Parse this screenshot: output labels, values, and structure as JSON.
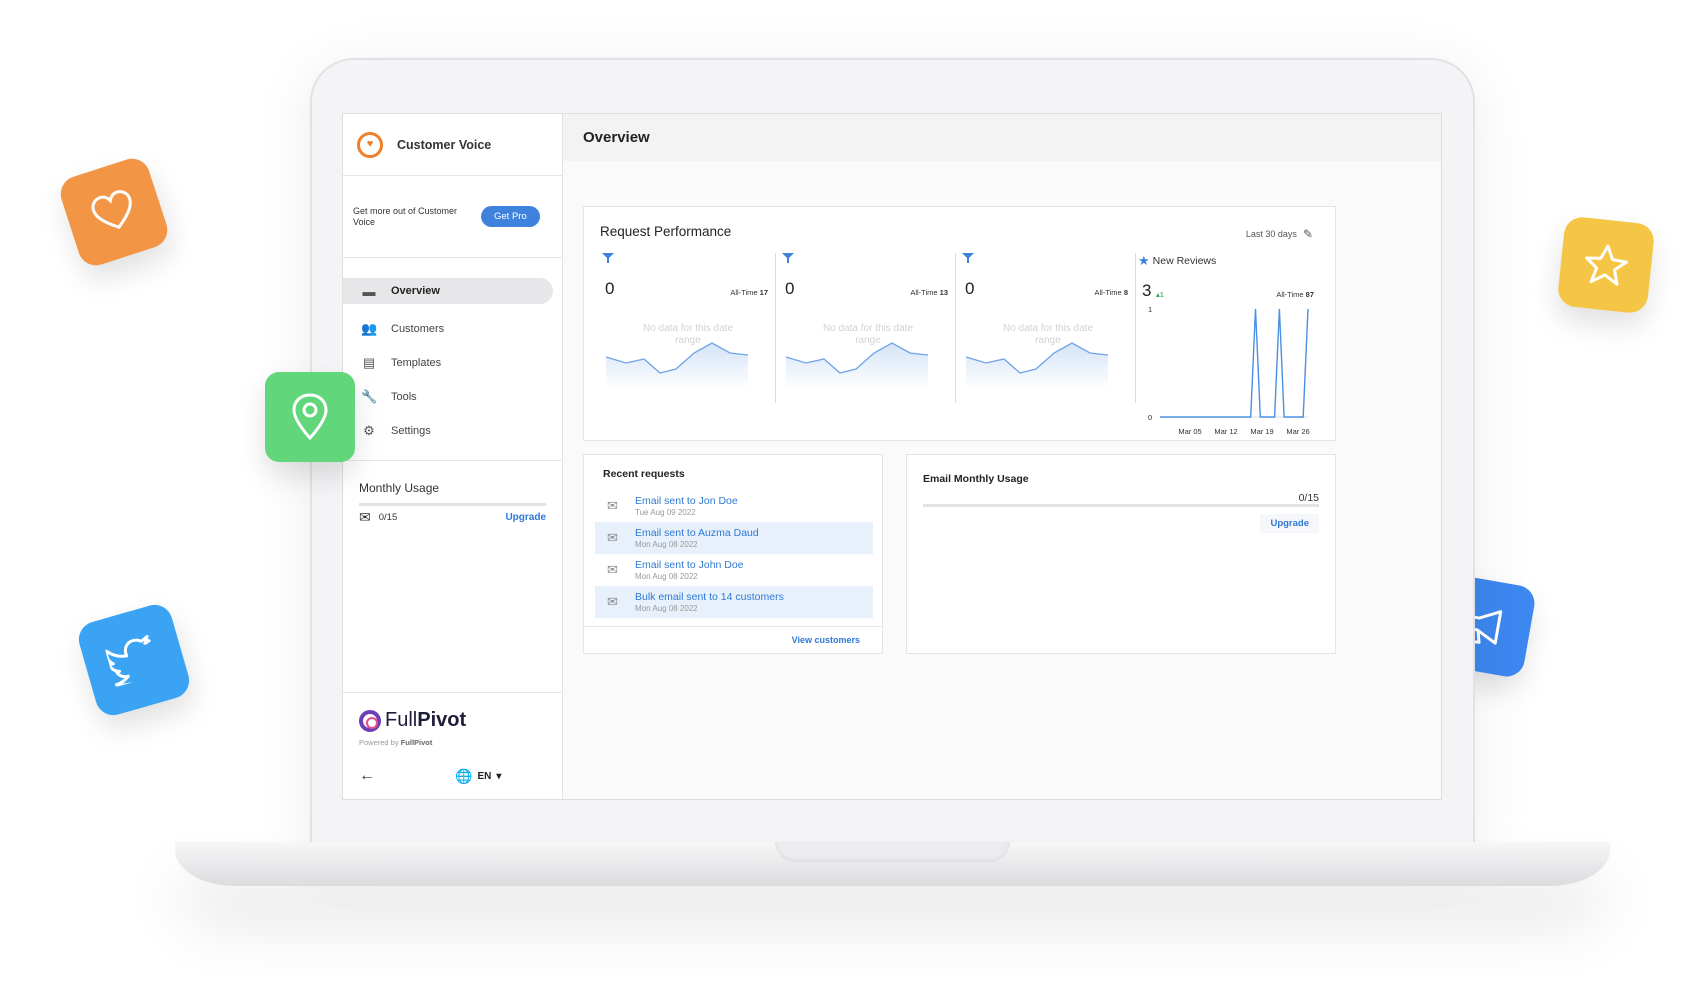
{
  "app": {
    "name": "Customer Voice",
    "promo_text": "Get more out of Customer Voice",
    "get_pro_label": "Get Pro"
  },
  "sidebar": {
    "items": [
      {
        "label": "Overview",
        "icon": "dashboard-icon",
        "glyph": "▬"
      },
      {
        "label": "Customers",
        "icon": "people-icon",
        "glyph": "👥"
      },
      {
        "label": "Templates",
        "icon": "template-icon",
        "glyph": "▤"
      },
      {
        "label": "Tools",
        "icon": "wrench-icon",
        "glyph": "🔧"
      },
      {
        "label": "Settings",
        "icon": "gear-icon",
        "glyph": "⚙"
      }
    ],
    "usage": {
      "title": "Monthly Usage",
      "count": "0/15",
      "upgrade_label": "Upgrade"
    }
  },
  "footer": {
    "brand_light": "Full",
    "brand_bold": "Pivot",
    "powered_prefix": "Powered by",
    "powered_brand": "FullPivot",
    "language": "EN"
  },
  "main": {
    "title": "Overview",
    "performance": {
      "title": "Request Performance",
      "range_label": "Last 30 days",
      "alltime_label": "All-Time",
      "no_data_text": "No data for this date range",
      "metrics": [
        {
          "value": "0",
          "alltime": "17"
        },
        {
          "value": "0",
          "alltime": "13"
        },
        {
          "value": "0",
          "alltime": "8"
        }
      ],
      "reviews": {
        "title": "New Reviews",
        "value": "3",
        "delta": "1",
        "alltime": "87"
      }
    },
    "recent_requests": {
      "title": "Recent requests",
      "items": [
        {
          "label": "Email sent to Jon Doe",
          "date": "Tue Aug 09 2022"
        },
        {
          "label": "Email sent to Auzma Daud",
          "date": "Mon Aug 08 2022"
        },
        {
          "label": "Email sent to John Doe",
          "date": "Mon Aug 08 2022"
        },
        {
          "label": "Bulk email sent to 14 customers",
          "date": "Mon Aug 08 2022"
        }
      ],
      "view_customers_label": "View customers"
    },
    "email_usage": {
      "title": "Email Monthly Usage",
      "count": "0/15",
      "upgrade_label": "Upgrade"
    }
  },
  "chart_data": {
    "type": "line",
    "title": "New Reviews",
    "x_tick_labels": [
      "Mar 05",
      "Mar 12",
      "Mar 19",
      "Mar 26"
    ],
    "y_tick_labels": [
      "0",
      "1"
    ],
    "ylim": [
      0,
      1
    ],
    "series": [
      {
        "values": [
          0,
          0,
          0,
          0,
          0,
          0,
          0,
          0,
          0,
          0,
          0,
          0,
          0,
          0,
          0,
          0,
          0,
          0,
          0,
          0,
          1,
          0,
          0,
          0,
          0,
          1,
          0,
          0,
          0,
          0,
          0,
          1
        ]
      }
    ]
  },
  "colors": {
    "accent": "#3f82dd",
    "link": "#2f79d6",
    "brand_orange": "#f07f2a",
    "positive": "#1a9d4b"
  }
}
